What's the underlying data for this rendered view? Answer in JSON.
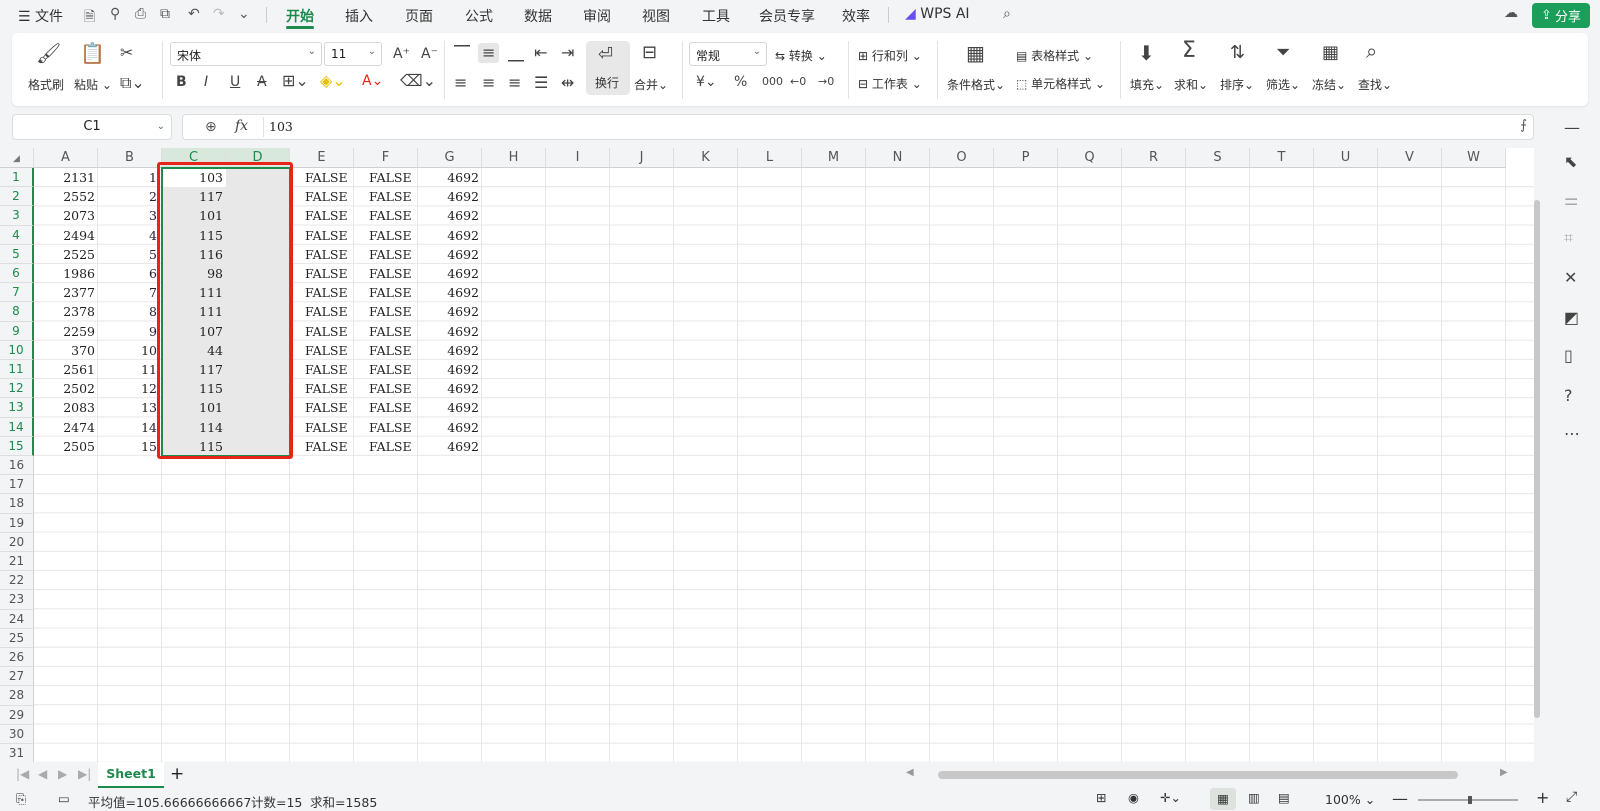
{
  "menubar": {
    "file": "文件",
    "tabs": [
      "开始",
      "插入",
      "页面",
      "公式",
      "数据",
      "审阅",
      "视图",
      "工具",
      "会员专享",
      "效率"
    ],
    "wps_ai": "WPS AI",
    "share": "分享"
  },
  "ribbon": {
    "format_painter": "格式刷",
    "paste": "粘贴",
    "font_name": "宋体",
    "font_size": "11",
    "wrap": "换行",
    "merge": "合并",
    "number_format": "常规",
    "convert": "转换",
    "rows_cols": "行和列",
    "worksheet": "工作表",
    "conditional_format": "条件格式",
    "table_style": "表格样式",
    "cell_style": "单元格样式",
    "fill": "填充",
    "sum": "求和",
    "sort": "排序",
    "filter": "筛选",
    "freeze": "冻结",
    "find": "查找"
  },
  "formula_bar": {
    "name_box": "C1",
    "fx": "fx",
    "value": "103"
  },
  "columns": [
    "A",
    "B",
    "C",
    "D",
    "E",
    "F",
    "G",
    "H",
    "I",
    "J",
    "K",
    "L",
    "M",
    "N",
    "O",
    "P",
    "Q",
    "R",
    "S",
    "T",
    "U",
    "V",
    "W"
  ],
  "rows": [
    "1",
    "2",
    "3",
    "4",
    "5",
    "6",
    "7",
    "8",
    "9",
    "10",
    "11",
    "12",
    "13",
    "14",
    "15",
    "16",
    "17",
    "18",
    "19",
    "20",
    "21",
    "22",
    "23",
    "24",
    "25",
    "26",
    "27",
    "28",
    "29",
    "30",
    "31"
  ],
  "data": {
    "A": [
      "2131",
      "2552",
      "2073",
      "2494",
      "2525",
      "1986",
      "2377",
      "2378",
      "2259",
      "370",
      "2561",
      "2502",
      "2083",
      "2474",
      "2505"
    ],
    "B": [
      "1",
      "2",
      "3",
      "4",
      "5",
      "6",
      "7",
      "8",
      "9",
      "10",
      "11",
      "12",
      "13",
      "14",
      "15"
    ],
    "C": [
      "103",
      "117",
      "101",
      "115",
      "116",
      "98",
      "111",
      "111",
      "107",
      "44",
      "117",
      "115",
      "101",
      "114",
      "115"
    ],
    "E": [
      "FALSE",
      "FALSE",
      "FALSE",
      "FALSE",
      "FALSE",
      "FALSE",
      "FALSE",
      "FALSE",
      "FALSE",
      "FALSE",
      "FALSE",
      "FALSE",
      "FALSE",
      "FALSE",
      "FALSE"
    ],
    "F": [
      "FALSE",
      "FALSE",
      "FALSE",
      "FALSE",
      "FALSE",
      "FALSE",
      "FALSE",
      "FALSE",
      "FALSE",
      "FALSE",
      "FALSE",
      "FALSE",
      "FALSE",
      "FALSE",
      "FALSE"
    ],
    "G": [
      "4692",
      "4692",
      "4692",
      "4692",
      "4692",
      "4692",
      "4692",
      "4692",
      "4692",
      "4692",
      "4692",
      "4692",
      "4692",
      "4692",
      "4692"
    ]
  },
  "sheet_tab": "Sheet1",
  "status": {
    "average": "平均值=105.66666666667",
    "count": "计数=15",
    "sum": "求和=1585",
    "zoom": "100%"
  },
  "colors": {
    "accent": "#1e8a4c",
    "highlight": "#e8231a",
    "share_bg": "#1a9e5a"
  }
}
